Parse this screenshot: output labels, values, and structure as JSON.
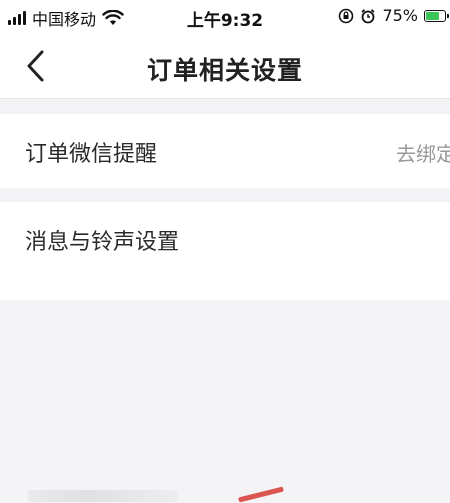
{
  "status_bar": {
    "carrier": "中国移动",
    "time": "上午9:32",
    "battery_percent": "75%",
    "battery_level": 0.75
  },
  "nav": {
    "title": "订单相关设置"
  },
  "settings": {
    "wechat_reminder": {
      "label": "订单微信提醒",
      "value": "去绑定"
    },
    "sound": {
      "label": "消息与铃声设置"
    }
  },
  "colors": {
    "background": "#f4f4f6",
    "row_background": "#ffffff",
    "secondary_text": "#999999",
    "battery": "#3ac45a"
  },
  "icons": [
    "signal-icon",
    "wifi-icon",
    "orientation-lock-icon",
    "alarm-icon",
    "battery-icon",
    "back-chevron-icon"
  ]
}
